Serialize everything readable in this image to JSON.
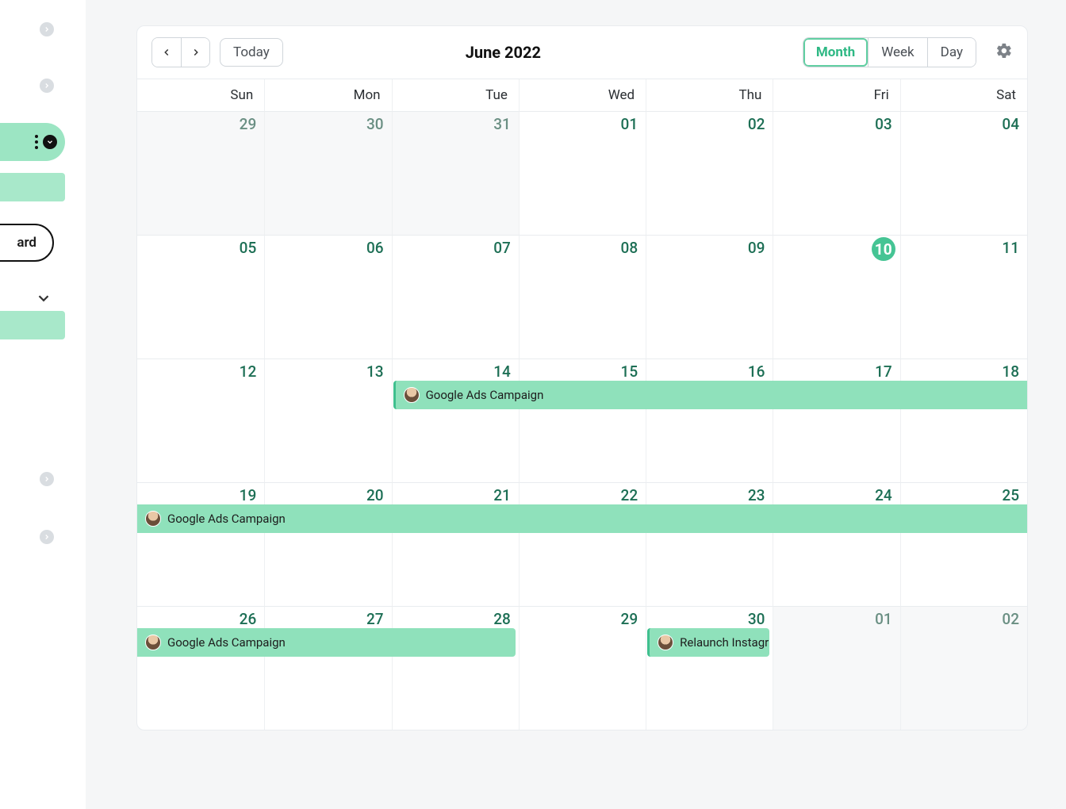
{
  "sidebar": {
    "dashboard_label": "ard"
  },
  "toolbar": {
    "today_label": "Today",
    "title": "June 2022",
    "views": {
      "month": "Month",
      "week": "Week",
      "day": "Day"
    }
  },
  "dow": [
    "Sun",
    "Mon",
    "Tue",
    "Wed",
    "Thu",
    "Fri",
    "Sat"
  ],
  "today_date": "10",
  "weeks": [
    [
      {
        "n": "29",
        "other": true
      },
      {
        "n": "30",
        "other": true
      },
      {
        "n": "31",
        "other": true
      },
      {
        "n": "01"
      },
      {
        "n": "02"
      },
      {
        "n": "03"
      },
      {
        "n": "04"
      }
    ],
    [
      {
        "n": "05"
      },
      {
        "n": "06"
      },
      {
        "n": "07"
      },
      {
        "n": "08"
      },
      {
        "n": "09"
      },
      {
        "n": "10",
        "today": true
      },
      {
        "n": "11"
      }
    ],
    [
      {
        "n": "12"
      },
      {
        "n": "13"
      },
      {
        "n": "14"
      },
      {
        "n": "15"
      },
      {
        "n": "16"
      },
      {
        "n": "17"
      },
      {
        "n": "18"
      }
    ],
    [
      {
        "n": "19"
      },
      {
        "n": "20"
      },
      {
        "n": "21"
      },
      {
        "n": "22"
      },
      {
        "n": "23"
      },
      {
        "n": "24"
      },
      {
        "n": "25"
      }
    ],
    [
      {
        "n": "26"
      },
      {
        "n": "27"
      },
      {
        "n": "28"
      },
      {
        "n": "29"
      },
      {
        "n": "30"
      },
      {
        "n": "01",
        "other": true
      },
      {
        "n": "02",
        "other": true
      }
    ]
  ],
  "events": [
    {
      "title": "Google Ads Campaign",
      "week": 2,
      "startCol": 2,
      "span": 5,
      "openEnd": true
    },
    {
      "title": "Google Ads Campaign",
      "week": 3,
      "startCol": 0,
      "span": 7,
      "openEnd": true,
      "openStart": true
    },
    {
      "title": "Google Ads Campaign",
      "week": 4,
      "startCol": 0,
      "span": 3,
      "openStart": true
    },
    {
      "title": "Relaunch Instagr",
      "week": 4,
      "startCol": 4,
      "span": 1
    }
  ]
}
